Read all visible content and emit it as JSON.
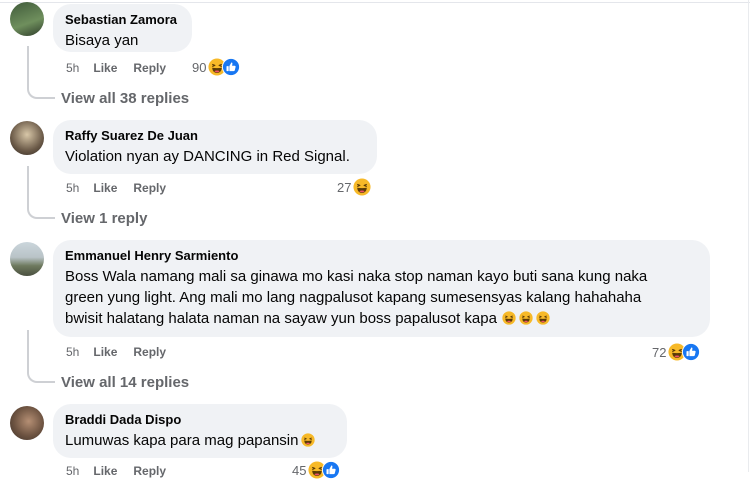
{
  "comments": [
    {
      "author": "Sebastian Zamora",
      "text": "Bisaya yan",
      "time": "5h",
      "like": "Like",
      "reply": "Reply",
      "reactions": "90",
      "replies": "View all 38 replies"
    },
    {
      "author": "Raffy Suarez De Juan",
      "text": "Violation nyan ay DANCING in Red Signal.",
      "time": "5h",
      "like": "Like",
      "reply": "Reply",
      "reactions": "27",
      "replies": "View 1 reply"
    },
    {
      "author": "Emmanuel Henry Sarmiento",
      "text_lines": [
        "Boss Wala namang mali sa ginawa mo kasi naka stop naman kayo buti sana kung naka",
        "green yung light. Ang mali mo lang nagpalusot kapang sumesensyas kalang hahahaha",
        "bwisit halatang halata naman na sayaw yun boss papalusot kapa"
      ],
      "time": "5h",
      "like": "Like",
      "reply": "Reply",
      "reactions": "72",
      "replies": "View all 14 replies"
    },
    {
      "author": "Braddi Dada Dispo",
      "text": "Lumuwas kapa para mag papansin",
      "time": "5h",
      "like": "Like",
      "reply": "Reply",
      "reactions": "45"
    }
  ],
  "icons": {
    "haha": "haha-emoji-icon",
    "like": "like-reaction-icon"
  },
  "colors": {
    "bubble": "#f0f2f5",
    "meta": "#65676b",
    "like_blue": "#1877f2",
    "haha_yellow": "#f7b928"
  }
}
